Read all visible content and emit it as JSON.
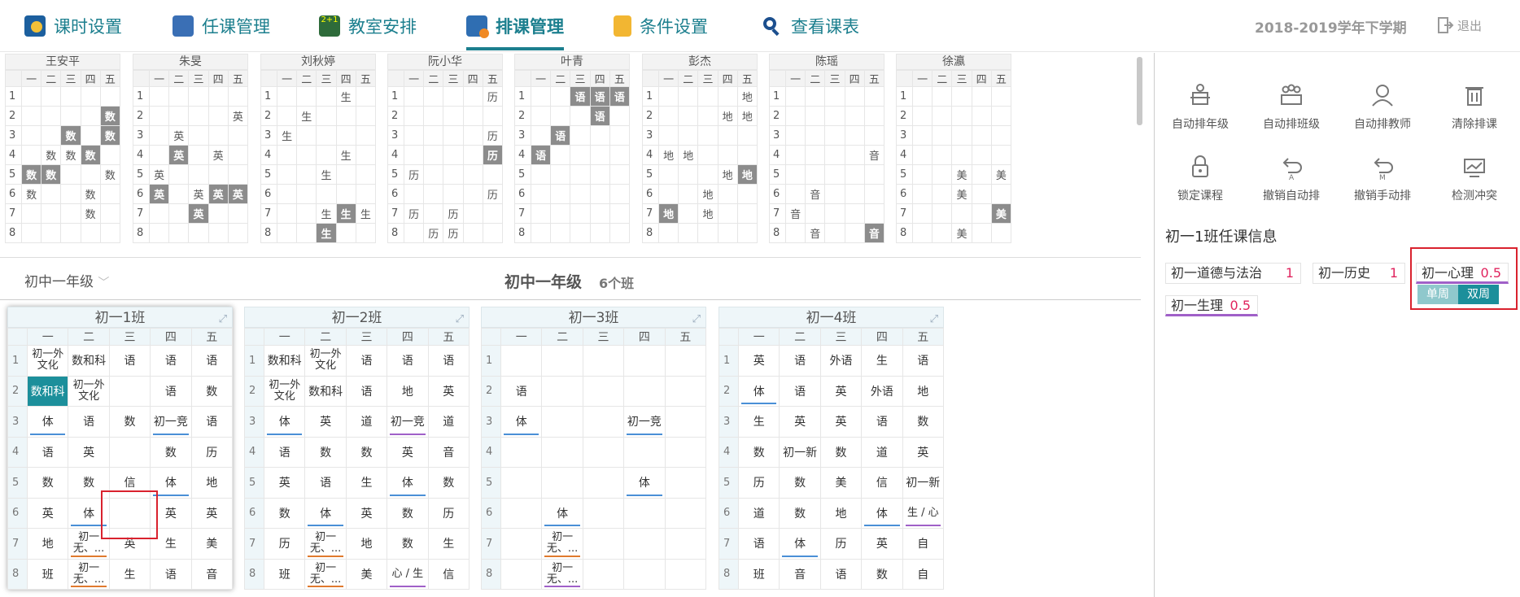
{
  "nav": {
    "items": [
      {
        "label": "课时设置",
        "icon": "clock-icon"
      },
      {
        "label": "任课管理",
        "icon": "teacher-edit-icon"
      },
      {
        "label": "教室安排",
        "icon": "blackboard-icon"
      },
      {
        "label": "排课管理",
        "icon": "schedule-grid-icon"
      },
      {
        "label": "条件设置",
        "icon": "document-icon"
      },
      {
        "label": "查看课表",
        "icon": "search-icon"
      }
    ],
    "term": "2018-2019学年下学期",
    "logout": "退出"
  },
  "teachers": [
    {
      "name": "王安平",
      "cells": [
        [
          "",
          "",
          "",
          "",
          ""
        ],
        [
          "",
          "",
          "",
          "",
          "数"
        ],
        [
          "",
          "",
          "数",
          "",
          "数"
        ],
        [
          "",
          "数",
          "数",
          "数",
          ""
        ],
        [
          "数",
          "数",
          "",
          "",
          "数"
        ],
        [
          "数",
          "",
          "",
          "数",
          ""
        ],
        [
          "",
          "",
          "",
          "数",
          ""
        ],
        [
          "",
          "",
          "",
          "",
          ""
        ]
      ],
      "gray": [
        [
          1,
          4
        ],
        [
          2,
          2
        ],
        [
          2,
          4
        ],
        [
          3,
          3
        ],
        [
          4,
          0
        ],
        [
          4,
          1
        ]
      ]
    },
    {
      "name": "朱旻",
      "cells": [
        [
          "",
          "",
          "",
          "",
          ""
        ],
        [
          "",
          "",
          "",
          "",
          "英"
        ],
        [
          "",
          "英",
          "",
          "",
          ""
        ],
        [
          "",
          "英",
          "",
          "英",
          ""
        ],
        [
          "英",
          "",
          "",
          "",
          ""
        ],
        [
          "英",
          "",
          "英",
          "英",
          "英"
        ],
        [
          "",
          "",
          "英",
          "",
          ""
        ],
        [
          "",
          "",
          "",
          "",
          ""
        ]
      ],
      "gray": [
        [
          3,
          1
        ],
        [
          5,
          0
        ],
        [
          5,
          3
        ],
        [
          5,
          4
        ],
        [
          6,
          2
        ]
      ]
    },
    {
      "name": "刘秋婷",
      "cells": [
        [
          "",
          "",
          "",
          "生",
          ""
        ],
        [
          "",
          "生",
          "",
          "",
          ""
        ],
        [
          "生",
          "",
          "",
          "",
          ""
        ],
        [
          "",
          "",
          "",
          "生",
          ""
        ],
        [
          "",
          "",
          "生",
          "",
          ""
        ],
        [
          "",
          "",
          "",
          "",
          ""
        ],
        [
          "",
          "",
          "生",
          "生",
          "生"
        ],
        [
          "",
          "",
          "生",
          "",
          ""
        ]
      ],
      "gray": [
        [
          6,
          3
        ],
        [
          7,
          2
        ]
      ]
    },
    {
      "name": "阮小华",
      "cells": [
        [
          "",
          "",
          "",
          "",
          "历"
        ],
        [
          "",
          "",
          "",
          "",
          ""
        ],
        [
          "",
          "",
          "",
          "",
          "历"
        ],
        [
          "",
          "",
          "",
          "",
          "历"
        ],
        [
          "历",
          "",
          "",
          "",
          ""
        ],
        [
          "",
          "",
          "",
          "",
          "历"
        ],
        [
          "历",
          "",
          "历",
          "",
          ""
        ],
        [
          "",
          "历",
          "历",
          "",
          ""
        ]
      ],
      "gray": [
        [
          3,
          4
        ]
      ]
    },
    {
      "name": "叶青",
      "cells": [
        [
          "",
          "",
          "语",
          "语",
          "语"
        ],
        [
          "",
          "",
          "",
          "语",
          ""
        ],
        [
          "",
          "语",
          "",
          "",
          ""
        ],
        [
          "语",
          "",
          "",
          "",
          ""
        ],
        [
          "",
          "",
          "",
          "",
          ""
        ],
        [
          "",
          "",
          "",
          "",
          ""
        ],
        [
          "",
          "",
          "",
          "",
          ""
        ],
        [
          "",
          "",
          "",
          "",
          ""
        ]
      ],
      "gray": [
        [
          0,
          2
        ],
        [
          0,
          3
        ],
        [
          0,
          4
        ],
        [
          1,
          3
        ],
        [
          2,
          1
        ],
        [
          3,
          0
        ]
      ]
    },
    {
      "name": "彭杰",
      "cells": [
        [
          "",
          "",
          "",
          "",
          "地"
        ],
        [
          "",
          "",
          "",
          "地",
          "地"
        ],
        [
          "",
          "",
          "",
          "",
          ""
        ],
        [
          "地",
          "地",
          "",
          "",
          ""
        ],
        [
          "",
          "",
          "",
          "地",
          "地"
        ],
        [
          "",
          "",
          "地",
          "",
          ""
        ],
        [
          "地",
          "",
          "地",
          "",
          ""
        ],
        [
          "",
          "",
          "",
          "",
          ""
        ]
      ],
      "gray": [
        [
          4,
          4
        ],
        [
          6,
          0
        ]
      ]
    },
    {
      "name": "陈瑶",
      "cells": [
        [
          "",
          "",
          "",
          "",
          ""
        ],
        [
          "",
          "",
          "",
          "",
          ""
        ],
        [
          "",
          "",
          "",
          "",
          ""
        ],
        [
          "",
          "",
          "",
          "",
          "音"
        ],
        [
          "",
          "",
          "",
          "",
          ""
        ],
        [
          "",
          "音",
          "",
          "",
          ""
        ],
        [
          "音",
          "",
          "",
          "",
          ""
        ],
        [
          "",
          "音",
          "",
          "",
          "音"
        ]
      ],
      "gray": [
        [
          7,
          4
        ]
      ]
    },
    {
      "name": "徐瀛",
      "cells": [
        [
          "",
          "",
          "",
          "",
          ""
        ],
        [
          "",
          "",
          "",
          "",
          ""
        ],
        [
          "",
          "",
          "",
          "",
          ""
        ],
        [
          "",
          "",
          "",
          "",
          ""
        ],
        [
          "",
          "",
          "美",
          "",
          "美"
        ],
        [
          "",
          "",
          "美",
          "",
          ""
        ],
        [
          "",
          "",
          "",
          "",
          "美"
        ],
        [
          "",
          "",
          "美",
          "",
          ""
        ]
      ],
      "gray": [
        [
          6,
          4
        ]
      ]
    }
  ],
  "weekdays": [
    "一",
    "二",
    "三",
    "四",
    "五"
  ],
  "periods": [
    "1",
    "2",
    "3",
    "4",
    "5",
    "6",
    "7",
    "8"
  ],
  "grade": {
    "selector": "初中一年级",
    "title": "初中一年级",
    "count": "6个班"
  },
  "classes": [
    {
      "name": "初一1班",
      "cells": [
        [
          "初一外文化",
          "数和科",
          "语",
          "语",
          "语"
        ],
        [
          "数和科",
          "初一外文化",
          "",
          "语",
          "数"
        ],
        [
          "体",
          "语",
          "数",
          "初一竞",
          "语"
        ],
        [
          "语",
          "英",
          "",
          "数",
          "历"
        ],
        [
          "数",
          "数",
          "信",
          "体",
          "地"
        ],
        [
          "英",
          "体",
          "",
          "英",
          "英"
        ],
        [
          "地",
          "初一无、...",
          "英",
          "生",
          "美"
        ],
        [
          "班",
          "初一无、...",
          "生",
          "语",
          "音"
        ]
      ]
    },
    {
      "name": "初一2班",
      "cells": [
        [
          "数和科",
          "初一外文化",
          "语",
          "语",
          "语"
        ],
        [
          "初一外文化",
          "数和科",
          "语",
          "地",
          "英"
        ],
        [
          "体",
          "英",
          "道",
          "初一竞",
          "道"
        ],
        [
          "语",
          "数",
          "数",
          "英",
          "音"
        ],
        [
          "英",
          "语",
          "生",
          "体",
          "数"
        ],
        [
          "数",
          "体",
          "英",
          "数",
          "历"
        ],
        [
          "历",
          "初一无、...",
          "地",
          "数",
          "生"
        ],
        [
          "班",
          "初一无、...",
          "美",
          "心 / 生",
          "信"
        ]
      ]
    },
    {
      "name": "初一3班",
      "cells": [
        [
          "",
          "",
          "",
          "",
          ""
        ],
        [
          "语",
          "",
          "",
          "",
          ""
        ],
        [
          "体",
          "",
          "",
          "初一竞",
          ""
        ],
        [
          "",
          "",
          "",
          "",
          ""
        ],
        [
          "",
          "",
          "",
          "体",
          ""
        ],
        [
          "",
          "体",
          "",
          "",
          ""
        ],
        [
          "",
          "初一无、...",
          "",
          "",
          ""
        ],
        [
          "",
          "初一无、...",
          "",
          "",
          ""
        ]
      ]
    },
    {
      "name": "初一4班",
      "cells": [
        [
          "英",
          "语",
          "外语",
          "生",
          "语"
        ],
        [
          "体",
          "语",
          "英",
          "外语",
          "地"
        ],
        [
          "生",
          "英",
          "英",
          "语",
          "数"
        ],
        [
          "数",
          "初一新",
          "数",
          "道",
          "英"
        ],
        [
          "历",
          "数",
          "美",
          "信",
          "初一新"
        ],
        [
          "道",
          "数",
          "地",
          "体",
          "生 / 心"
        ],
        [
          "语",
          "体",
          "历",
          "英",
          "自"
        ],
        [
          "班",
          "音",
          "语",
          "数",
          "自"
        ]
      ]
    }
  ],
  "tools": [
    {
      "label": "自动排年级",
      "icon": "podium-icon"
    },
    {
      "label": "自动排班级",
      "icon": "group-icon"
    },
    {
      "label": "自动排教师",
      "icon": "teacher-icon"
    },
    {
      "label": "清除排课",
      "icon": "trash-icon"
    },
    {
      "label": "锁定课程",
      "icon": "lock-icon"
    },
    {
      "label": "撤销自动排",
      "icon": "undo-auto-icon"
    },
    {
      "label": "撤销手动排",
      "icon": "undo-manual-icon"
    },
    {
      "label": "检测冲突",
      "icon": "monitor-icon"
    }
  ],
  "info": {
    "title": "初一1班任课信息",
    "subjects": [
      {
        "name": "初一道德与法治",
        "count": "1"
      },
      {
        "name": "初一历史",
        "count": "1"
      },
      {
        "name": "初一心理",
        "count": "0.5"
      },
      {
        "name": "初一生理",
        "count": "0.5"
      }
    ],
    "week_single": "单周",
    "week_double": "双周"
  },
  "colors": {
    "accent": "#1c7f8e",
    "highlight": "#d9222e",
    "count": "#e0245e"
  }
}
